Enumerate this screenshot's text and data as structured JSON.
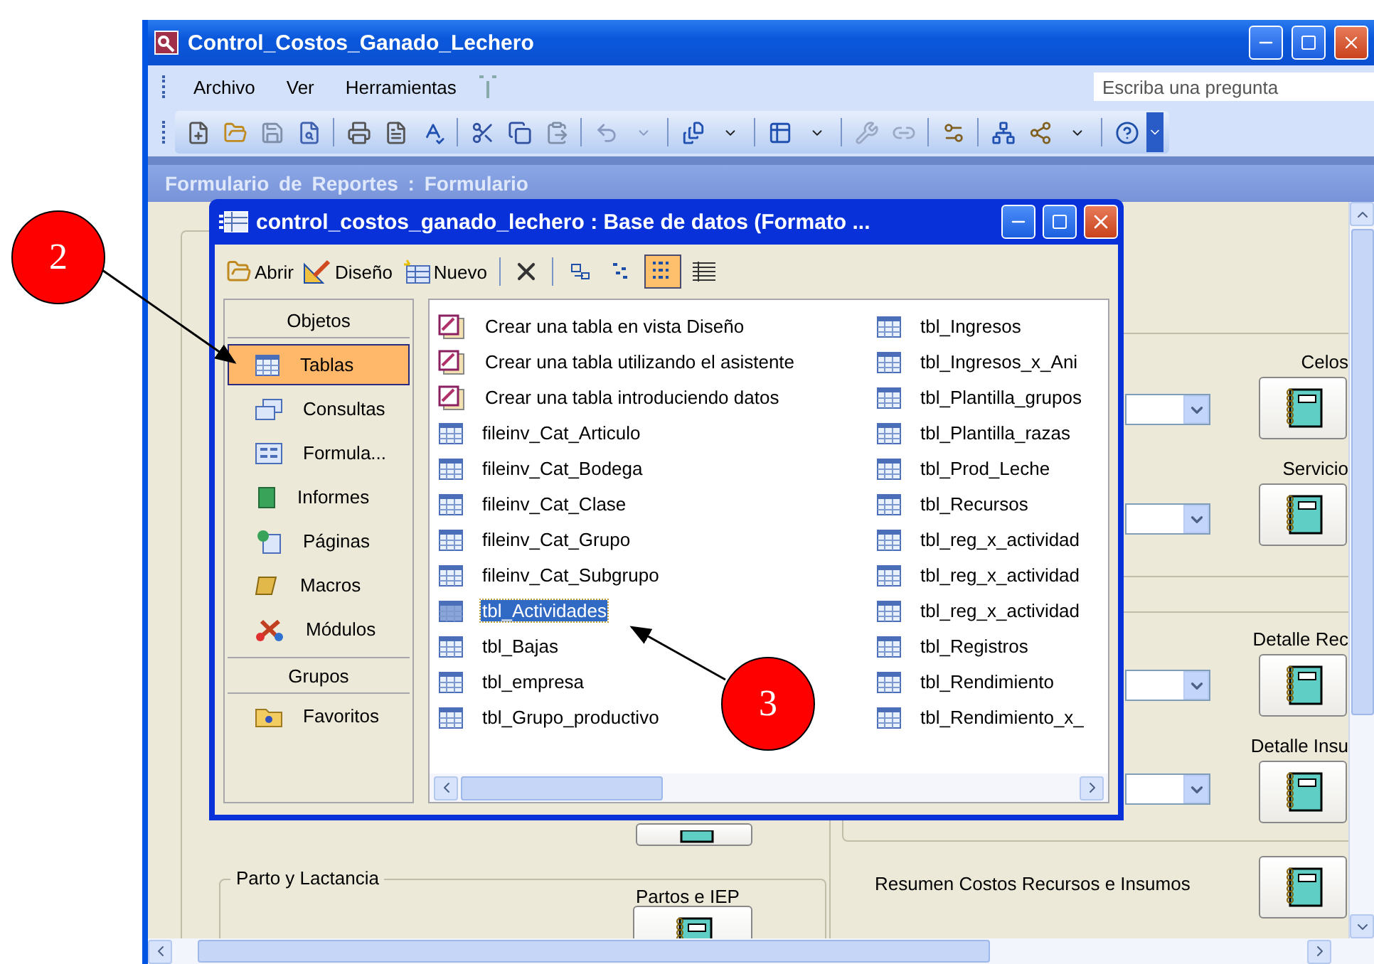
{
  "app_window": {
    "title": "Control_Costos_Ganado_Lechero"
  },
  "menu": [
    {
      "label": "Archivo"
    },
    {
      "label": "Ver"
    },
    {
      "label": "Herramientas"
    }
  ],
  "help_search": {
    "placeholder": "Escriba una pregunta"
  },
  "form_window": {
    "title": "Formulario de Reportes : Formulario"
  },
  "form": {
    "group_label": "Parto y Lactancia",
    "partos_label": "Partos e IEP",
    "summary_label": "Resumen Costos Recursos e Insumos",
    "report_buttons": [
      {
        "label": "Celos"
      },
      {
        "label": "Servicio"
      },
      {
        "label": "Detalle Rec"
      },
      {
        "label": "Detalle Insu"
      }
    ]
  },
  "database_window": {
    "title": "control_costos_ganado_lechero : Base de datos (Formato ...",
    "toolbar": [
      {
        "label": "Abrir",
        "kind": "open"
      },
      {
        "label": "Diseño",
        "kind": "design"
      },
      {
        "label": "Nuevo",
        "kind": "new"
      }
    ],
    "views": [
      {
        "kind": "large",
        "selected": false
      },
      {
        "kind": "small",
        "selected": false
      },
      {
        "kind": "list",
        "selected": true
      },
      {
        "kind": "details",
        "selected": false
      }
    ],
    "objects_header": "Objetos",
    "objects": [
      {
        "label": "Tablas",
        "kind": "table",
        "selected": true
      },
      {
        "label": "Consultas",
        "kind": "query",
        "selected": false
      },
      {
        "label": "Formula...",
        "kind": "form",
        "selected": false
      },
      {
        "label": "Informes",
        "kind": "report",
        "selected": false
      },
      {
        "label": "Páginas",
        "kind": "page",
        "selected": false
      },
      {
        "label": "Macros",
        "kind": "macro",
        "selected": false
      },
      {
        "label": "Módulos",
        "kind": "module",
        "selected": false
      }
    ],
    "groups_header": "Grupos",
    "groups": [
      {
        "label": "Favoritos"
      }
    ],
    "items": [
      {
        "label": "Crear una tabla en vista Diseño",
        "kind": "shortcut",
        "selected": false
      },
      {
        "label": "Crear una tabla utilizando el asistente",
        "kind": "shortcut",
        "selected": false
      },
      {
        "label": "Crear una tabla introduciendo datos",
        "kind": "shortcut",
        "selected": false
      },
      {
        "label": "fileinv_Cat_Articulo",
        "kind": "table",
        "selected": false
      },
      {
        "label": "fileinv_Cat_Bodega",
        "kind": "table",
        "selected": false
      },
      {
        "label": "fileinv_Cat_Clase",
        "kind": "table",
        "selected": false
      },
      {
        "label": "fileinv_Cat_Grupo",
        "kind": "table",
        "selected": false
      },
      {
        "label": "fileinv_Cat_Subgrupo",
        "kind": "table",
        "selected": false
      },
      {
        "label": "tbl_Actividades",
        "kind": "table",
        "selected": true
      },
      {
        "label": "tbl_Bajas",
        "kind": "table",
        "selected": false
      },
      {
        "label": "tbl_empresa",
        "kind": "table",
        "selected": false
      },
      {
        "label": "tbl_Grupo_productivo",
        "kind": "table",
        "selected": false
      },
      {
        "label": "tbl_Ingresos",
        "kind": "table",
        "selected": false
      },
      {
        "label": "tbl_Ingresos_x_Ani",
        "kind": "table",
        "selected": false
      },
      {
        "label": "tbl_Plantilla_grupos",
        "kind": "table",
        "selected": false
      },
      {
        "label": "tbl_Plantilla_razas",
        "kind": "table",
        "selected": false
      },
      {
        "label": "tbl_Prod_Leche",
        "kind": "table",
        "selected": false
      },
      {
        "label": "tbl_Recursos",
        "kind": "table",
        "selected": false
      },
      {
        "label": "tbl_reg_x_actividad",
        "kind": "table",
        "selected": false
      },
      {
        "label": "tbl_reg_x_actividad",
        "kind": "table",
        "selected": false
      },
      {
        "label": "tbl_reg_x_actividad",
        "kind": "table",
        "selected": false
      },
      {
        "label": "tbl_Registros",
        "kind": "table",
        "selected": false
      },
      {
        "label": "tbl_Rendimiento",
        "kind": "table",
        "selected": false
      },
      {
        "label": "tbl_Rendimiento_x_",
        "kind": "table",
        "selected": false
      }
    ]
  },
  "annotations": [
    {
      "number": "2"
    },
    {
      "number": "3"
    }
  ]
}
